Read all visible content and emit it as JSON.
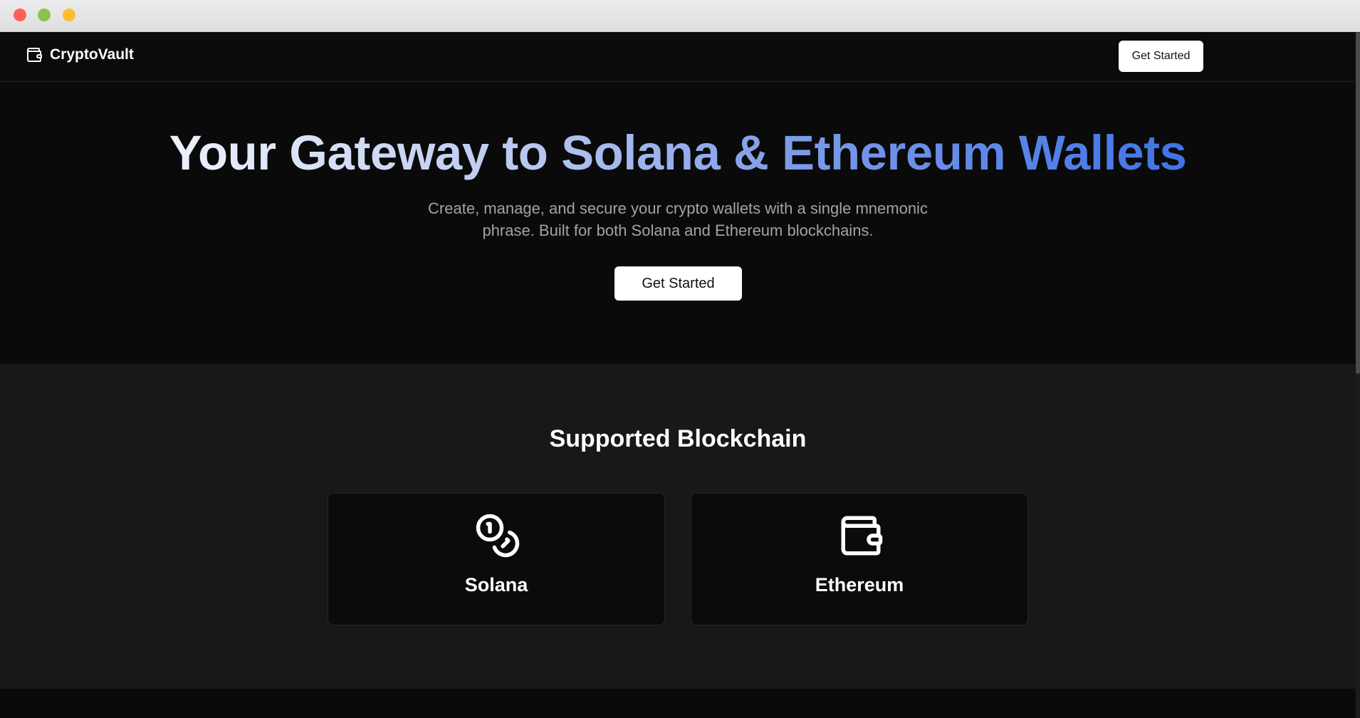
{
  "window": {
    "controls": {
      "close_color": "#ff5f57",
      "zoom_color": "#8bc34a",
      "minimize_color": "#febc2e"
    }
  },
  "navbar": {
    "brand_icon": "wallet-icon",
    "brand_name": "CryptoVault",
    "cta_label": "Get Started"
  },
  "hero": {
    "title": "Your Gateway to Solana & Ethereum Wallets",
    "subtitle": "Create, manage, and secure your crypto wallets with a single mnemonic phrase. Built for both Solana and Ethereum blockchains.",
    "cta_label": "Get Started",
    "title_gradient": [
      "#eef2fb",
      "#3f73e6"
    ]
  },
  "supported": {
    "title": "Supported Blockchain",
    "cards": [
      {
        "label": "Solana",
        "icon": "coins-icon"
      },
      {
        "label": "Ethereum",
        "icon": "wallet-icon"
      }
    ]
  },
  "colors": {
    "background": "#0a0a0a",
    "section_background": "#181818",
    "card_background": "#0b0b0b",
    "accent": "#3f73e6",
    "muted_text": "#a3a3a3"
  }
}
